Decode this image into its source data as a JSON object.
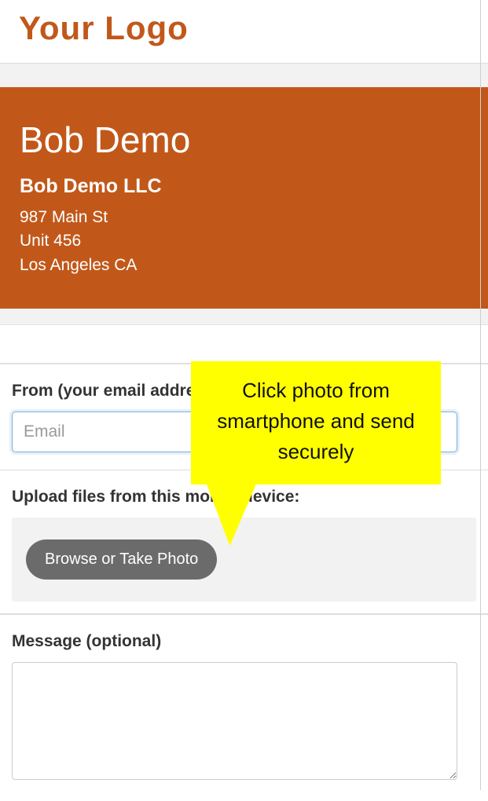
{
  "logo": {
    "text": "Your Logo"
  },
  "contact": {
    "name": "Bob Demo",
    "company": "Bob Demo LLC",
    "addr1": "987 Main St",
    "addr2": "Unit 456",
    "addr3": "Los Angeles CA"
  },
  "email": {
    "label": "From (your email address)",
    "placeholder": "Email"
  },
  "upload": {
    "label": "Upload files from this mobile device:",
    "button": "Browse or Take Photo"
  },
  "message": {
    "label": "Message (optional)"
  },
  "callout": {
    "text": "Click photo from smartphone and send securely"
  }
}
